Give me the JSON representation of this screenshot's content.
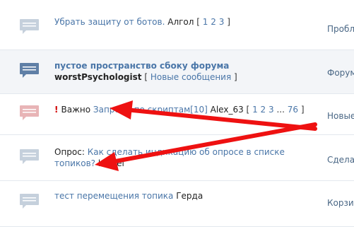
{
  "topics": [
    {
      "title": "Убрать защиту от ботов.",
      "author": "Алгол",
      "pages": [
        "1",
        "2",
        "3"
      ],
      "category": "Пробле",
      "icon": "topic-icon"
    },
    {
      "title": "пустое пространство сбоку форума",
      "author": "worstPsychologist",
      "new_label": "Новые сообщения",
      "category": "Форум",
      "icon": "topic-unread-icon"
    },
    {
      "flag": "!",
      "prefix": "Важно",
      "title": "Запросы по скриптам",
      "count": "[10]",
      "author": "Alex_63",
      "pages": [
        "1",
        "2",
        "3",
        "...",
        "76"
      ],
      "category": "Новые",
      "icon": "topic-important-icon"
    },
    {
      "prefix": "Опрос:",
      "title_line1": "Как сделать индикацию об опросе в списке",
      "title_line2": "топиков?",
      "author": "kernel",
      "category": "Сделат",
      "icon": "topic-icon"
    },
    {
      "title": "тест перемещения топика",
      "author": "Герда",
      "category": "Корзин",
      "icon": "topic-icon"
    }
  ],
  "colors": {
    "link": "#4a76a8",
    "icon_read": "#c5d0dc",
    "icon_unread": "#5f7fa6",
    "icon_important": "#e8b4b6",
    "important_mark": "#d00000",
    "arrow": "#ee1111"
  }
}
